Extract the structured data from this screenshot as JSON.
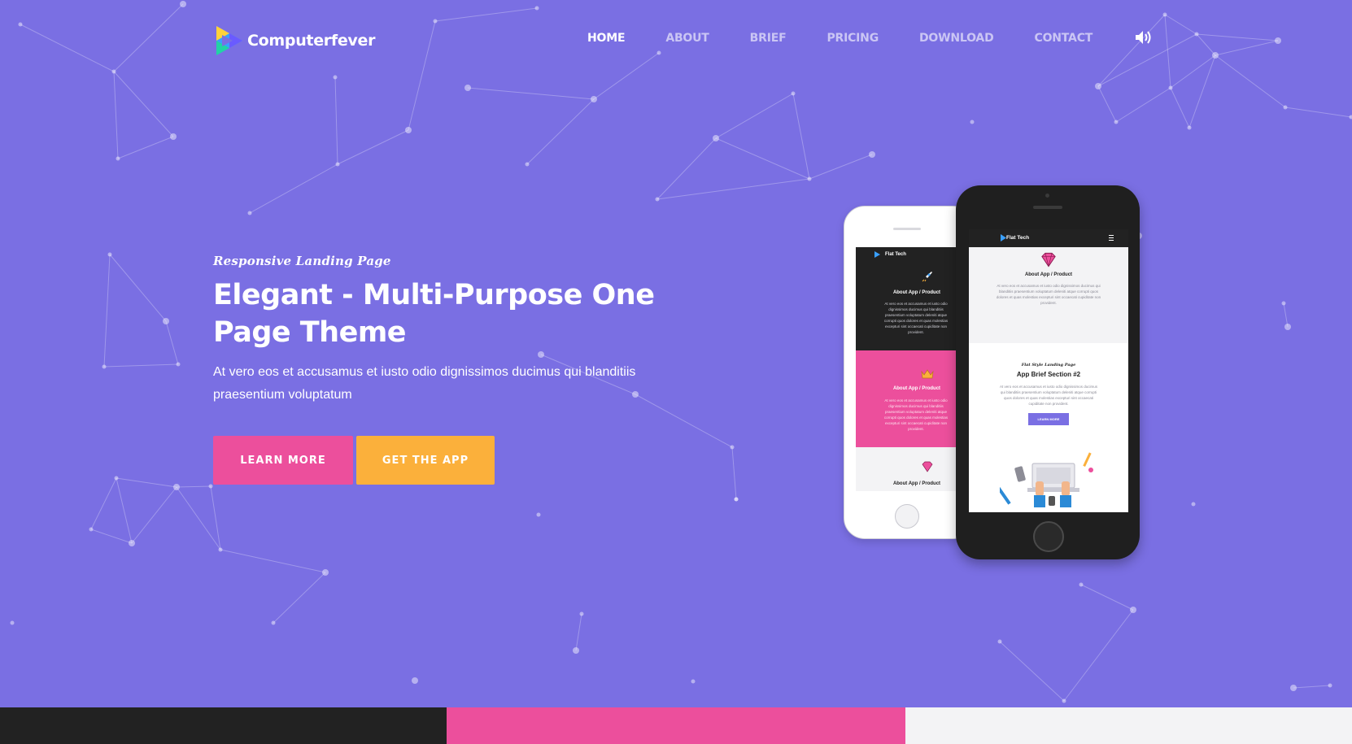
{
  "brand": {
    "name": "Computerfever",
    "logo_icon": "play-triangle-logo"
  },
  "nav": {
    "items": [
      "HOME",
      "ABOUT",
      "BRIEF",
      "PRICING",
      "DOWNLOAD",
      "CONTACT"
    ],
    "active": "HOME",
    "sound_icon": "volume-icon"
  },
  "hero": {
    "kicker": "Responsive Landing Page",
    "title_line1": "Elegant - Multi-Purpose One",
    "title_line2": "Page Theme",
    "lead_line1": "At vero eos et accusamus et iusto odio dignissimos ducimus qui blanditiis",
    "lead_line2": "praesentium voluptatum",
    "learn_more": "LEARN MORE",
    "get_app": "GET THE APP"
  },
  "mockup": {
    "brand": "Flat Tech",
    "section_heading": "About App / Product",
    "section_text": "At vero eos et accusamus et iusto odio dignissimos ducimus qui blanditiis praesentium voluptatum deleniti atque corrupti quos dolores et quas molestias excepturi sint occaecati cupiditate non provident.",
    "brief_kicker": "Flat Style Landing Page",
    "brief_title": "App Brief Section #2",
    "brief_text": "At vero eos et accusamus et iusto odio dignissimos ducimus qui blanditiis praesentium voluptatum deleniti atque corrupti quos dolores et quas molestias excepturi sint occaecati cupiditate non provident.",
    "learn_more": "LEARN MORE",
    "icons": [
      "rocket-icon",
      "crown-icon",
      "diamond-icon"
    ]
  },
  "colors": {
    "background": "#7a6fe3",
    "pink": "#ec4f9c",
    "orange": "#fbb03b",
    "dark": "#222222",
    "light": "#f3f3f5"
  }
}
